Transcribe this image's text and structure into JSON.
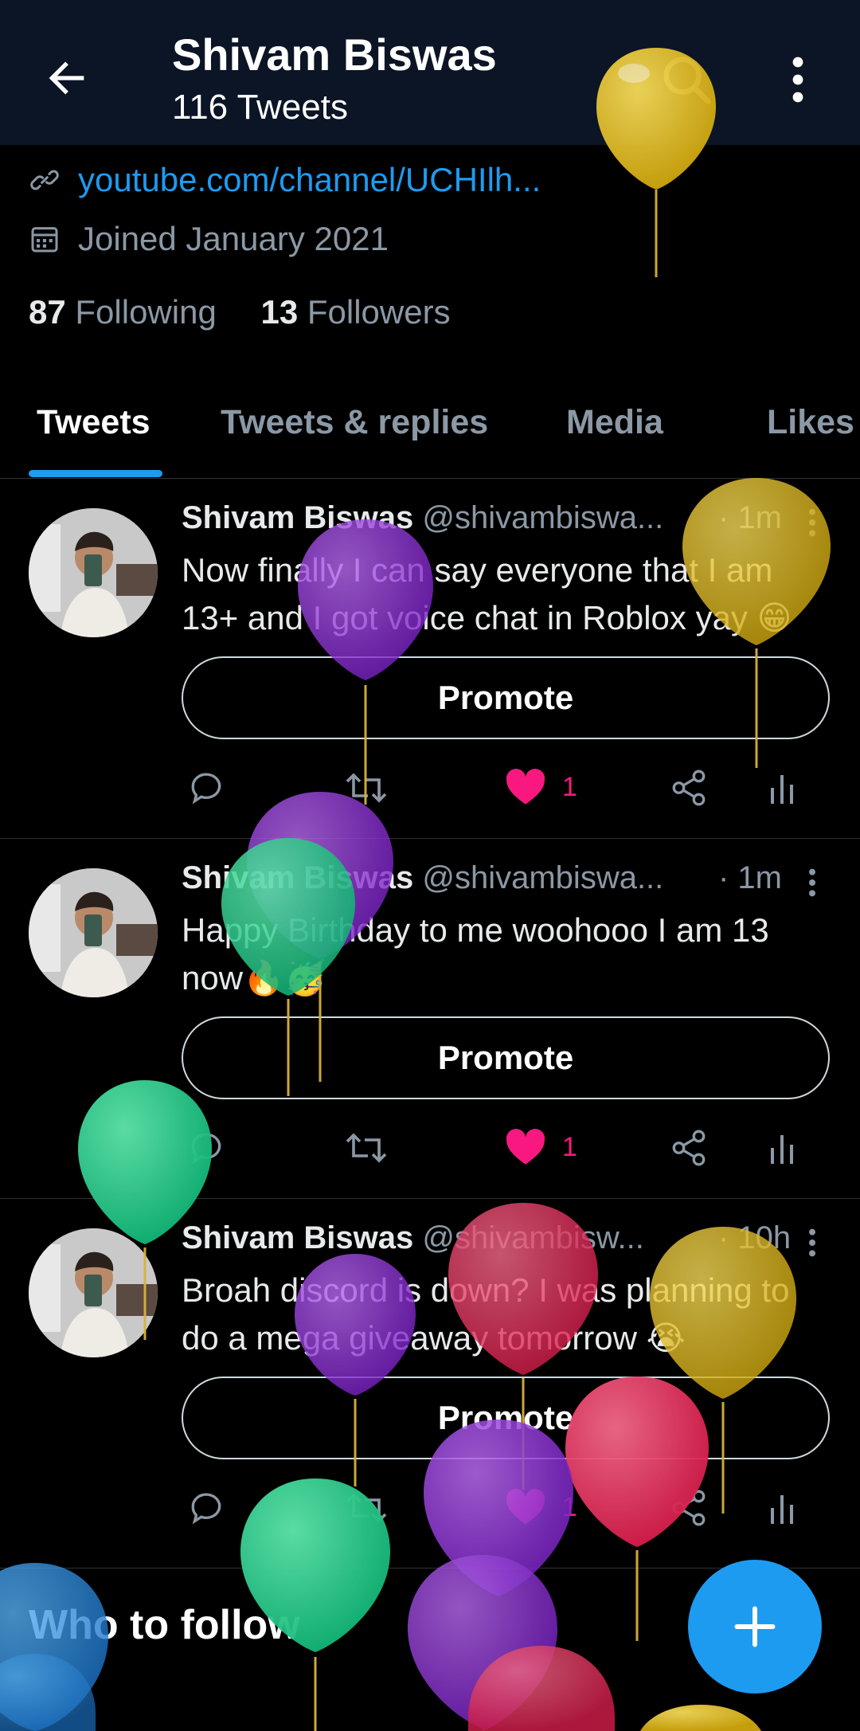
{
  "header": {
    "title": "Shivam Biswas",
    "subtitle": "116 Tweets"
  },
  "profile": {
    "link": "youtube.com/channel/UCHIlh...",
    "joined": "Joined January 2021",
    "following_count": "87",
    "following_label": "Following",
    "followers_count": "13",
    "followers_label": "Followers"
  },
  "tabs": [
    {
      "label": "Tweets",
      "active": true
    },
    {
      "label": "Tweets & replies",
      "active": false
    },
    {
      "label": "Media",
      "active": false
    },
    {
      "label": "Likes",
      "active": false
    }
  ],
  "tweets": [
    {
      "name": "Shivam Biswas",
      "handle": "@shivambiswa...",
      "time": "· 1m",
      "text": "Now finally I can say everyone that I am 13+ and I got voice chat in Roblox yay 😁",
      "promote": "Promote",
      "likes": "1"
    },
    {
      "name": "Shivam Biswas",
      "handle": "@shivambiswa...",
      "time": "· 1m",
      "text": "Happy Birthday to me woohooo I am 13 now🔥🥳",
      "promote": "Promote",
      "likes": "1"
    },
    {
      "name": "Shivam Biswas",
      "handle": "@shivambisw...",
      "time": "· 10h",
      "text": "Broah discord is down? I was planning to do a mega giveaway tomorrow 😭",
      "promote": "Promote",
      "likes": "1"
    }
  ],
  "who_to_follow": "Who to follow",
  "colors": {
    "accent": "#1d9bf0",
    "like": "#f91880",
    "header_bg": "#0b1526"
  }
}
